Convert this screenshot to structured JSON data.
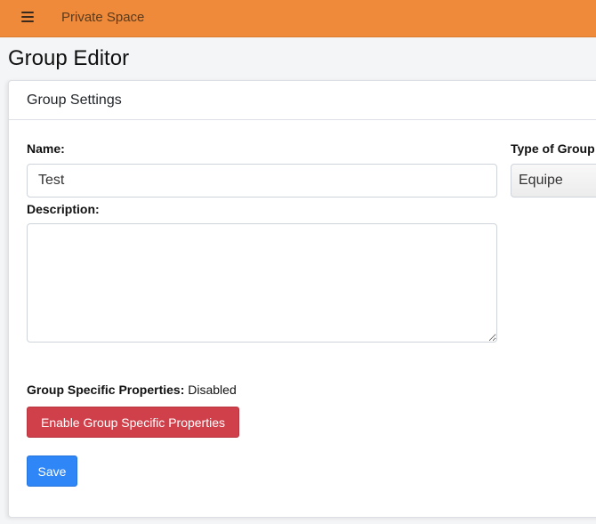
{
  "navbar": {
    "menu_icon": "hamburger-menu-icon",
    "brand": "Private Space",
    "background_color": "#ee8a3a"
  },
  "page": {
    "title": "Group Editor"
  },
  "card": {
    "header": "Group Settings",
    "name": {
      "label": "Name:",
      "value": "Test"
    },
    "description": {
      "label": "Description:",
      "value": ""
    },
    "type": {
      "label": "Type of Group",
      "selected": "Equipe"
    },
    "properties": {
      "label": "Group Specific Properties:",
      "status": "Disabled",
      "enable_button": "Enable Group Specific Properties",
      "button_color": "#d0404b"
    },
    "save_button": "Save",
    "save_color": "#2f86f6"
  }
}
